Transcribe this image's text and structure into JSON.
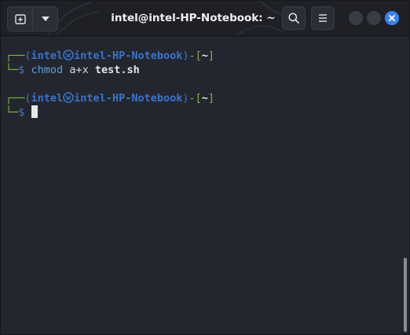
{
  "window": {
    "title": "intel@intel-HP-Notebook: ~"
  },
  "header": {
    "new_tab_icon": "new-tab-icon",
    "menu_dropdown_icon": "chevron-down-icon",
    "search_icon": "search-icon",
    "hamburger_icon": "hamburger-menu-icon",
    "close_icon": "close-icon",
    "close_color": "#3b82f0"
  },
  "terminal": {
    "prompt1": {
      "corner": "┌──",
      "open_paren": "(",
      "user": "intel",
      "host": "intel-HP-Notebook",
      "close_paren": ")",
      "dash": "-",
      "open_bracket": "[",
      "cwd": "~",
      "close_bracket": "]",
      "lower_corner": "└─",
      "dollar": "$",
      "command": "chmod",
      "args": "a+x",
      "file": "test.sh"
    },
    "prompt2": {
      "corner": "┌──",
      "open_paren": "(",
      "user": "intel",
      "host": "intel-HP-Notebook",
      "close_paren": ")",
      "dash": "-",
      "open_bracket": "[",
      "cwd": "~",
      "close_bracket": "]",
      "lower_corner": "└─",
      "dollar": "$"
    },
    "colors": {
      "frame": "#7eb83a",
      "user_host": "#3b74c9",
      "command": "#5aa0d8",
      "background": "#23262f"
    }
  }
}
